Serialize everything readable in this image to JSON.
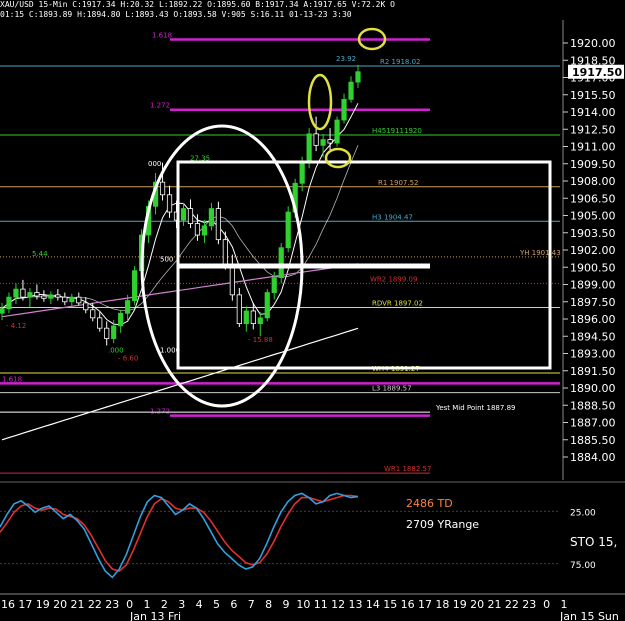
{
  "header": {
    "line1": "XAU/USD  15-Min  C:1917.34  H:20.32  L:1892.22  O:1895.60  B:1917.34  A:1917.65  V:72.2K  O",
    "line2": "01:15  C:1893.89  H:1894.80  L:1893.43  O:1893.58  V:905  S:16.11  01-13-23  3:30"
  },
  "chart_data": {
    "type": "candlestick",
    "title": "XAU/USD 15-Min",
    "price_axis": {
      "ylim": [
        1882,
        1922
      ],
      "ticks": [
        "1920.00",
        "1918.50",
        "1917.00",
        "1915.50",
        "1914.00",
        "1912.50",
        "1911.00",
        "1909.50",
        "1908.00",
        "1906.50",
        "1905.00",
        "1903.50",
        "1902.00",
        "1900.50",
        "1899.00",
        "1897.50",
        "1896.00",
        "1894.50",
        "1893.00",
        "1891.50",
        "1890.00",
        "1888.50",
        "1887.00",
        "1885.50",
        "1884.00"
      ],
      "last_price": "1917.50",
      "last_value": 1917.5
    },
    "time_axis": {
      "labels": [
        "16",
        "17",
        "19",
        "20",
        "21",
        "22",
        "23",
        "0",
        "1",
        "2",
        "3",
        "4",
        "5",
        "6",
        "7",
        "8",
        "9",
        "10",
        "11",
        "12",
        "13",
        "14",
        "15",
        "16",
        "17",
        "18",
        "19",
        "20",
        "21",
        "22",
        "23",
        "0",
        "1"
      ],
      "sublabels": [
        "Jan 13 Fri",
        "Jan 15 Sun"
      ]
    },
    "levels": [
      {
        "label": "1.618",
        "value": 1920.3,
        "color": "#d020d0",
        "style": "solid"
      },
      {
        "label": "R2 1918.02",
        "value": 1918.0,
        "color": "#4aa8c8",
        "style": "solid"
      },
      {
        "label": "23.92",
        "value": 1918.25,
        "color": "#4aa8c8",
        "style": "none"
      },
      {
        "label": "1.272",
        "value": 1914.2,
        "color": "#d020d0",
        "style": "solid"
      },
      {
        "label": "H4519111920",
        "value": 1912.0,
        "color": "#30d030",
        "style": "solid"
      },
      {
        "label": "R1 1907.52",
        "value": 1907.5,
        "color": "#d0a060",
        "style": "solid"
      },
      {
        "label": "H3 1904.47",
        "value": 1904.5,
        "color": "#4aa8c8",
        "style": "solid"
      },
      {
        "label": "YH 1901.43",
        "value": 1901.4,
        "color": "#d0a060",
        "style": "dotted"
      },
      {
        "label": "WR2 1899.09",
        "value": 1899.1,
        "color": "#d03030",
        "style": "dotted"
      },
      {
        "label": "RDVR 1897.02",
        "value": 1897.0,
        "color": "#e0e040",
        "style": "solid"
      },
      {
        "label": "WH4 1891.27",
        "value": 1891.3,
        "color": "#e0e040",
        "style": "solid"
      },
      {
        "label": "1.618",
        "value": 1890.4,
        "color": "#d020d0",
        "style": "solid"
      },
      {
        "label": "L3 1889.57",
        "value": 1889.6,
        "color": "#cccccc",
        "style": "solid"
      },
      {
        "label": "1.272",
        "value": 1887.6,
        "color": "#d020d0",
        "style": "solid"
      },
      {
        "label": "Yest Mid Point 1887.89",
        "value": 1887.9,
        "color": "#ffffff",
        "style": "solid"
      },
      {
        "label": "WR1 1882.57",
        "value": 1882.6,
        "color": "#d03030",
        "style": "solid"
      }
    ],
    "annotations": [
      {
        "text": "5.44",
        "value": 1901.5,
        "color": "#30d030"
      },
      {
        "text": "- 4.12",
        "value": 1895.2,
        "color": "#d03030"
      },
      {
        "text": ".000",
        "value": 1893.1,
        "color": "#30d030"
      },
      {
        "text": "- 6.60",
        "value": 1892.4,
        "color": "#d03030"
      },
      {
        "text": "27.35",
        "value": 1909.8,
        "color": "#30d030"
      },
      {
        "text": "500",
        "value": 1901.0,
        "color": "#ffffff"
      },
      {
        "text": "1.000",
        "value": 1893.1,
        "color": "#ffffff"
      },
      {
        "text": "- 15.88",
        "value": 1894.0,
        "color": "#d03030"
      },
      {
        "text": "000",
        "value": 1909.3,
        "color": "#ffffff"
      }
    ],
    "candles": [
      [
        1896.5,
        1897.4,
        1895.9,
        1896.9
      ],
      [
        1896.9,
        1898.3,
        1896.5,
        1897.9
      ],
      [
        1897.9,
        1899.1,
        1897.3,
        1898.6
      ],
      [
        1898.6,
        1899.4,
        1897.6,
        1897.9
      ],
      [
        1897.9,
        1898.7,
        1897.0,
        1898.3
      ],
      [
        1898.3,
        1899.0,
        1897.7,
        1898.0
      ],
      [
        1898.0,
        1898.5,
        1897.5,
        1897.8
      ],
      [
        1897.8,
        1898.4,
        1897.3,
        1898.1
      ],
      [
        1898.1,
        1898.6,
        1897.6,
        1897.9
      ],
      [
        1897.9,
        1898.3,
        1897.2,
        1897.5
      ],
      [
        1897.5,
        1898.2,
        1897.1,
        1897.9
      ],
      [
        1897.9,
        1898.3,
        1897.2,
        1897.4
      ],
      [
        1897.4,
        1897.9,
        1896.5,
        1896.8
      ],
      [
        1896.8,
        1897.4,
        1895.8,
        1896.1
      ],
      [
        1896.1,
        1896.6,
        1894.9,
        1895.2
      ],
      [
        1895.2,
        1895.8,
        1893.7,
        1894.3
      ],
      [
        1894.3,
        1895.9,
        1893.9,
        1895.4
      ],
      [
        1895.4,
        1896.8,
        1894.8,
        1896.5
      ],
      [
        1896.5,
        1898.1,
        1895.9,
        1897.6
      ],
      [
        1897.6,
        1900.6,
        1897.2,
        1900.2
      ],
      [
        1900.2,
        1903.8,
        1899.7,
        1903.3
      ],
      [
        1903.3,
        1906.3,
        1902.6,
        1905.8
      ],
      [
        1905.8,
        1908.7,
        1905.1,
        1907.9
      ],
      [
        1907.9,
        1909.6,
        1906.3,
        1906.8
      ],
      [
        1906.8,
        1907.6,
        1904.8,
        1905.3
      ],
      [
        1905.3,
        1906.3,
        1903.9,
        1904.6
      ],
      [
        1904.6,
        1906.1,
        1904.1,
        1905.6
      ],
      [
        1905.6,
        1906.4,
        1903.9,
        1904.3
      ],
      [
        1904.3,
        1905.1,
        1902.8,
        1903.3
      ],
      [
        1903.3,
        1904.6,
        1902.6,
        1904.1
      ],
      [
        1904.1,
        1906.1,
        1903.7,
        1905.6
      ],
      [
        1905.6,
        1906.2,
        1902.5,
        1902.9
      ],
      [
        1902.9,
        1903.6,
        1900.3,
        1900.6
      ],
      [
        1900.6,
        1901.6,
        1897.6,
        1898.1
      ],
      [
        1898.1,
        1898.7,
        1895.3,
        1895.6
      ],
      [
        1895.6,
        1897.1,
        1894.9,
        1896.7
      ],
      [
        1896.7,
        1897.4,
        1895.1,
        1895.6
      ],
      [
        1895.6,
        1896.6,
        1894.5,
        1896.1
      ],
      [
        1896.1,
        1898.6,
        1895.8,
        1898.3
      ],
      [
        1898.3,
        1900.1,
        1897.7,
        1899.6
      ],
      [
        1899.6,
        1902.6,
        1899.1,
        1902.2
      ],
      [
        1902.2,
        1905.8,
        1901.8,
        1905.3
      ],
      [
        1905.3,
        1908.2,
        1904.8,
        1907.8
      ],
      [
        1907.8,
        1910.1,
        1907.1,
        1909.6
      ],
      [
        1909.6,
        1912.6,
        1909.1,
        1912.1
      ],
      [
        1912.1,
        1913.6,
        1910.6,
        1911.1
      ],
      [
        1911.1,
        1912.1,
        1910.1,
        1911.6
      ],
      [
        1911.6,
        1912.6,
        1910.6,
        1911.3
      ],
      [
        1911.3,
        1913.6,
        1911.0,
        1913.3
      ],
      [
        1913.3,
        1915.6,
        1913.0,
        1915.1
      ],
      [
        1915.1,
        1917.1,
        1914.8,
        1916.6
      ],
      [
        1916.6,
        1918.1,
        1916.1,
        1917.5
      ]
    ],
    "oscillator": {
      "label": "STO  15,",
      "ticks": [
        "25.00",
        "75.00"
      ],
      "info": [
        "2486 TD",
        "2709 YRange"
      ],
      "k": [
        60,
        72,
        82,
        85,
        80,
        74,
        78,
        80,
        74,
        68,
        72,
        66,
        58,
        44,
        30,
        18,
        12,
        20,
        34,
        52,
        70,
        84,
        90,
        88,
        80,
        72,
        76,
        82,
        78,
        68,
        56,
        44,
        36,
        30,
        24,
        20,
        22,
        30,
        44,
        60,
        74,
        84,
        90,
        92,
        88,
        82,
        84,
        90,
        92,
        90,
        88,
        89
      ],
      "d": [
        55,
        64,
        74,
        80,
        82,
        78,
        76,
        78,
        77,
        72,
        70,
        68,
        62,
        52,
        40,
        28,
        20,
        18,
        24,
        38,
        54,
        70,
        82,
        87,
        84,
        78,
        76,
        78,
        78,
        74,
        66,
        56,
        46,
        38,
        32,
        26,
        24,
        26,
        34,
        46,
        60,
        72,
        82,
        88,
        88,
        86,
        84,
        86,
        88,
        90,
        90,
        89
      ]
    },
    "highlights": [
      {
        "kind": "ellipse",
        "color": "#ffffff",
        "region": "rally"
      },
      {
        "kind": "rectangle",
        "color": "#ffffff",
        "region": "range"
      },
      {
        "kind": "ellipse",
        "color": "#e0e040",
        "region": "1.618 target"
      },
      {
        "kind": "ellipse",
        "color": "#e0e040",
        "region": "spike"
      },
      {
        "kind": "ellipse",
        "color": "#e0e040",
        "region": "pullback"
      }
    ]
  }
}
